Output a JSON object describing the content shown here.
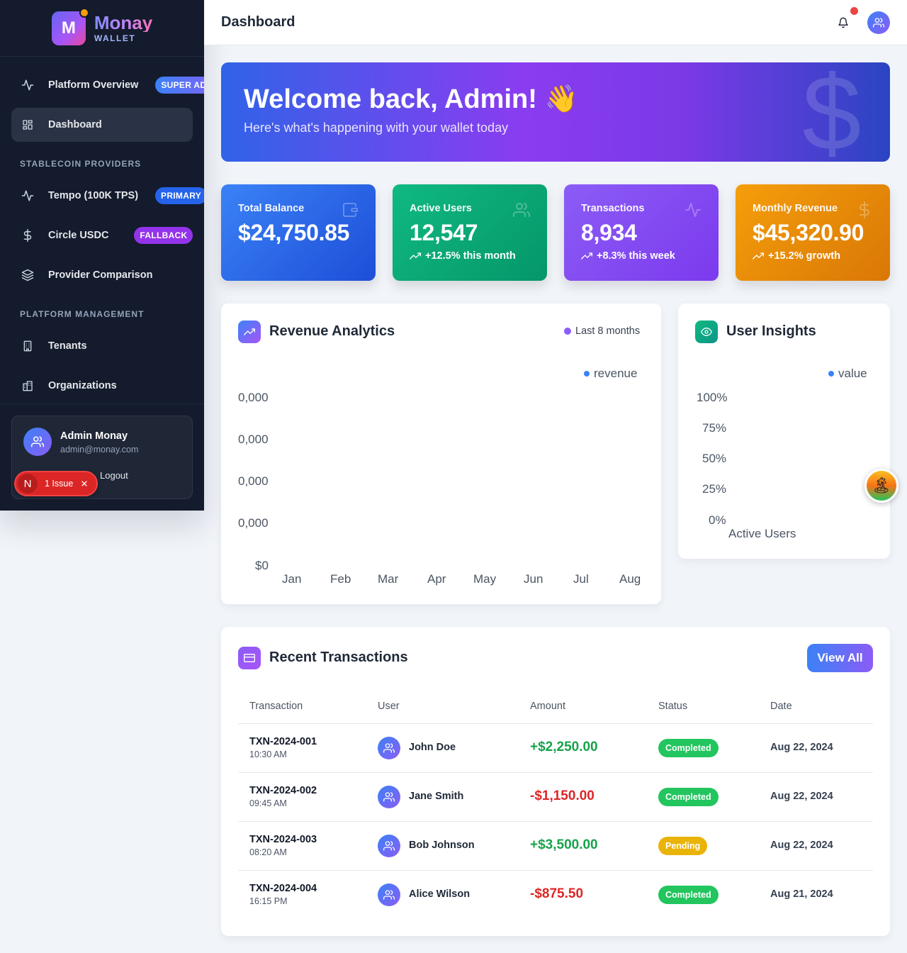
{
  "brand": {
    "letter": "M",
    "name": "Monay",
    "sub": "WALLET"
  },
  "nav": {
    "platform_overview": {
      "label": "Platform Overview",
      "badge": "SUPER ADMIN"
    },
    "dashboard": {
      "label": "Dashboard"
    },
    "section_stablecoin": "STABLECOIN PROVIDERS",
    "tempo": {
      "label": "Tempo (100K TPS)",
      "badge": "PRIMARY"
    },
    "circle": {
      "label": "Circle USDC",
      "badge": "FALLBACK"
    },
    "provider_comparison": {
      "label": "Provider Comparison"
    },
    "section_platform": "PLATFORM MANAGEMENT",
    "tenants": {
      "label": "Tenants"
    },
    "organizations": {
      "label": "Organizations"
    }
  },
  "user": {
    "name": "Admin Monay",
    "email": "admin@monay.com",
    "logout": "Logout"
  },
  "issue": {
    "letter": "N",
    "label": "1 Issue"
  },
  "header": {
    "title": "Dashboard"
  },
  "hero": {
    "title": "Welcome back, Admin! 👋",
    "subtitle": "Here's what's happening with your wallet today",
    "symbol": "$"
  },
  "stats": [
    {
      "label": "Total Balance",
      "value": "$24,750.85",
      "trend": "",
      "icon": "wallet-icon",
      "color_from": "#3b82f6",
      "color_to": "#1d4ed8"
    },
    {
      "label": "Active Users",
      "value": "12,547",
      "trend": "+12.5% this month",
      "icon": "users-icon",
      "color_from": "#10b981",
      "color_to": "#059669"
    },
    {
      "label": "Transactions",
      "value": "8,934",
      "trend": "+8.3% this week",
      "icon": "activity-icon",
      "color_from": "#8b5cf6",
      "color_to": "#7c3aed"
    },
    {
      "label": "Monthly Revenue",
      "value": "$45,320.90",
      "trend": "+15.2% growth",
      "icon": "dollar-icon",
      "color_from": "#f59e0b",
      "color_to": "#d97706"
    }
  ],
  "revenue": {
    "title": "Revenue Analytics",
    "period": "Last 8 months",
    "legend": "revenue",
    "y_ticks": [
      "0,000",
      "0,000",
      "0,000",
      "0,000",
      "$0"
    ],
    "x_ticks": [
      "Jan",
      "Feb",
      "Mar",
      "Apr",
      "May",
      "Jun",
      "Jul",
      "Aug"
    ]
  },
  "insights": {
    "title": "User Insights",
    "legend": "value",
    "y_ticks": [
      "100%",
      "75%",
      "50%",
      "25%",
      "0%"
    ],
    "x_label": "Active Users"
  },
  "transactions": {
    "title": "Recent Transactions",
    "view_all": "View All",
    "headers": [
      "Transaction",
      "User",
      "Amount",
      "Status",
      "Date"
    ],
    "rows": [
      {
        "id": "TXN-2024-001",
        "time": "10:30 AM",
        "user": "John Doe",
        "amount": "+$2,250.00",
        "status": "Completed",
        "date": "Aug 22, 2024"
      },
      {
        "id": "TXN-2024-002",
        "time": "09:45 AM",
        "user": "Jane Smith",
        "amount": "-$1,150.00",
        "status": "Completed",
        "date": "Aug 22, 2024"
      },
      {
        "id": "TXN-2024-003",
        "time": "08:20 AM",
        "user": "Bob Johnson",
        "amount": "+$3,500.00",
        "status": "Pending",
        "date": "Aug 22, 2024"
      },
      {
        "id": "TXN-2024-004",
        "time": "16:15 PM",
        "user": "Alice Wilson",
        "amount": "-$875.50",
        "status": "Completed",
        "date": "Aug 21, 2024"
      }
    ]
  },
  "colors": {
    "positive": "#16a34a",
    "negative": "#dc2626",
    "completed": "#22c55e",
    "pending": "#eab308",
    "accent": "#8b5cf6"
  }
}
